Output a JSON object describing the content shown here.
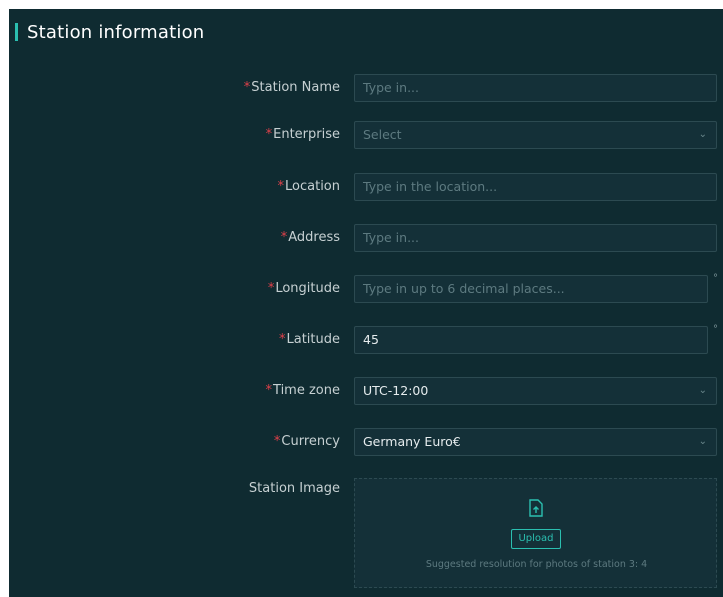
{
  "section": {
    "title": "Station information"
  },
  "fields": {
    "station_name": {
      "label": "Station Name",
      "placeholder": "Type in..."
    },
    "enterprise": {
      "label": "Enterprise",
      "placeholder": "Select"
    },
    "location": {
      "label": "Location",
      "placeholder": "Type in the location..."
    },
    "address": {
      "label": "Address",
      "placeholder": "Type in..."
    },
    "longitude": {
      "label": "Longitude",
      "placeholder": "Type in up to 6 decimal places..."
    },
    "latitude": {
      "label": "Latitude",
      "value": "45"
    },
    "time_zone": {
      "label": "Time zone",
      "value": "UTC-12:00"
    },
    "currency": {
      "label": "Currency",
      "value": "Germany Euro€"
    },
    "station_image": {
      "label": "Station Image",
      "upload_label": "Upload",
      "hint": "Suggested resolution for photos of  station 3: 4"
    }
  },
  "required_mark": "*",
  "degree_mark": "°",
  "icons": {
    "dropdown": "chevron-down-icon",
    "upload": "upload-file-icon"
  },
  "colors": {
    "background": "#0f2b31",
    "accent": "#2bbfb0",
    "required": "#e0404a"
  }
}
